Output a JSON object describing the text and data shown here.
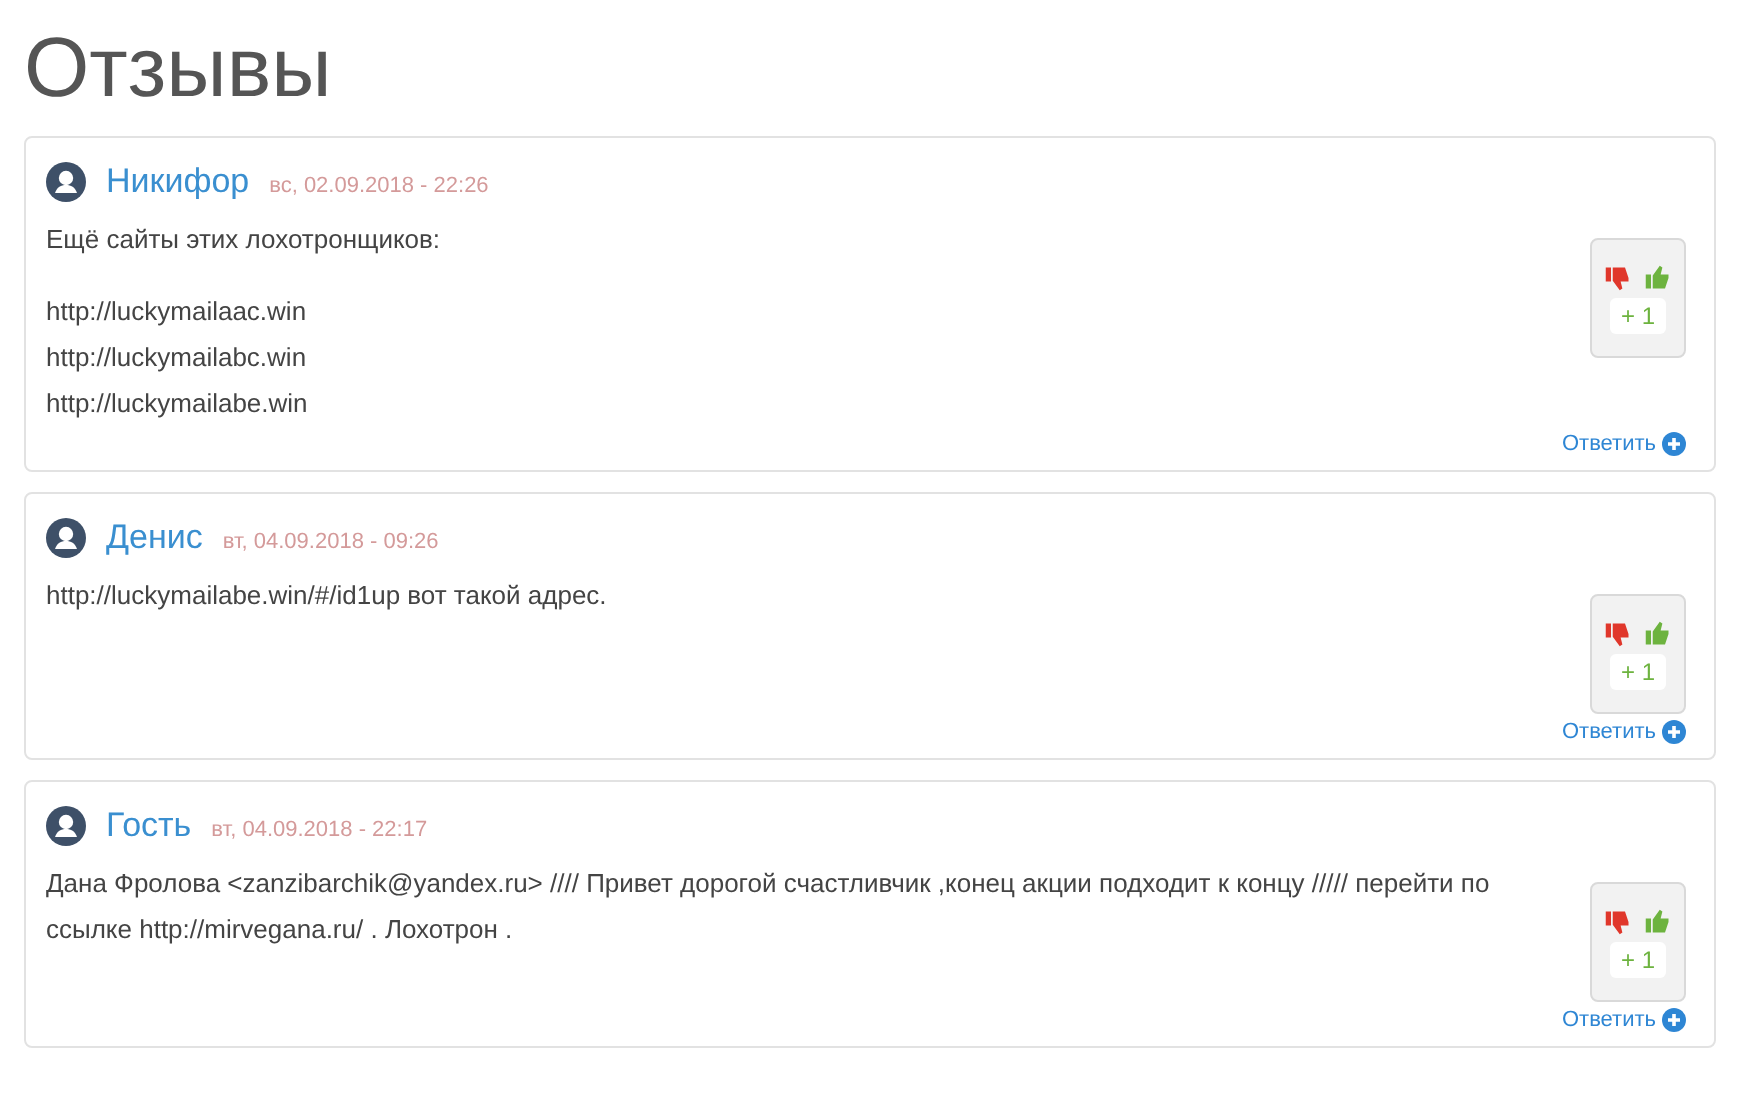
{
  "title": "Отзывы",
  "comments": [
    {
      "author": "Никифор",
      "date": "вс, 02.09.2018 - 22:26",
      "paragraphs": [
        [
          "Ещё сайты этих лохотронщиков:"
        ],
        [
          "http://luckymailaac.win",
          "http://luckymailabc.win",
          "http://luckymailabe.win"
        ]
      ],
      "score": "+ 1",
      "reply": "Ответить"
    },
    {
      "author": "Денис",
      "date": "вт, 04.09.2018 - 09:26",
      "paragraphs": [
        [
          "http://luckymailabe.win/#/id1up вот такой адрес."
        ]
      ],
      "score": "+ 1",
      "reply": "Ответить"
    },
    {
      "author": "Гость",
      "date": "вт, 04.09.2018 - 22:17",
      "paragraphs": [
        [
          "Дана Фролова <zanzibarchik@yandex.ru> //// Привет дорогой счастливчик ,конец акции подходит к концу ///// перейти по ссылке http://mirvegana.ru/ . Лохотрон ."
        ]
      ],
      "score": "+ 1",
      "reply": "Ответить"
    }
  ]
}
